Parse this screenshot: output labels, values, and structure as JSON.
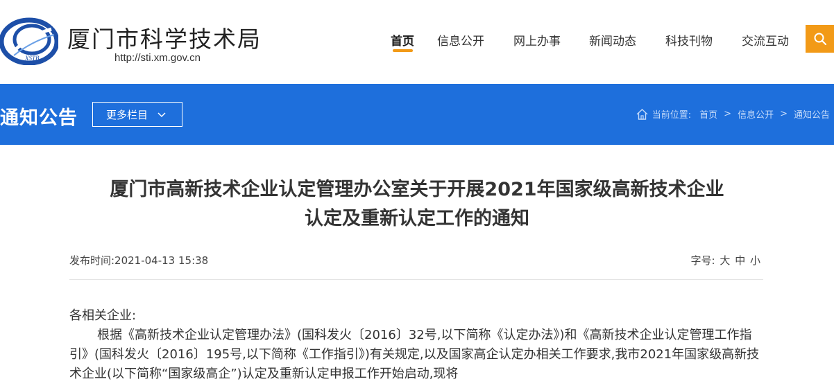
{
  "header": {
    "logo_text": "XSTB",
    "site_name": "厦门市科学技术局",
    "site_url": "http://sti.xm.gov.cn",
    "nav": [
      {
        "label": "首页",
        "active": true
      },
      {
        "label": "信息公开",
        "active": false
      },
      {
        "label": "网上办事",
        "active": false
      },
      {
        "label": "新闻动态",
        "active": false
      },
      {
        "label": "科技刊物",
        "active": false
      },
      {
        "label": "交流互动",
        "active": false
      }
    ],
    "search_icon": "search-icon"
  },
  "banner": {
    "title": "通知公告",
    "more_label": "更多栏目",
    "breadcrumb": {
      "prefix": "当前位置:",
      "items": [
        "首页",
        "信息公开",
        "通知公告"
      ],
      "separator": ">"
    }
  },
  "article": {
    "title_line1": "厦门市高新技术企业认定管理办公室关于开展2021年国家级高新技术企业",
    "title_line2": "认定及重新认定工作的通知",
    "publish_time": "发布时间:2021-04-13 15:38",
    "font_size_label": "字号:",
    "font_size_options": [
      "大",
      "中",
      "小"
    ],
    "body": [
      "各相关企业:",
      "根据《高新技术企业认定管理办法》(国科发火〔2016〕32号,以下简称《认定办法》)和《高新技术企业认定管理工作指引》(国科发火〔2016〕195号,以下简称《工作指引》)有关规定,以及国家高企认定办相关工作要求,我市2021年国家级高新技术企业(以下简称“国家级高企”)认定及重新认定申报工作开始启动,现将"
    ]
  },
  "colors": {
    "accent": "#f29a17",
    "banner_blue": "#1e6fdc",
    "logo_blue": "#1d4fa8"
  }
}
